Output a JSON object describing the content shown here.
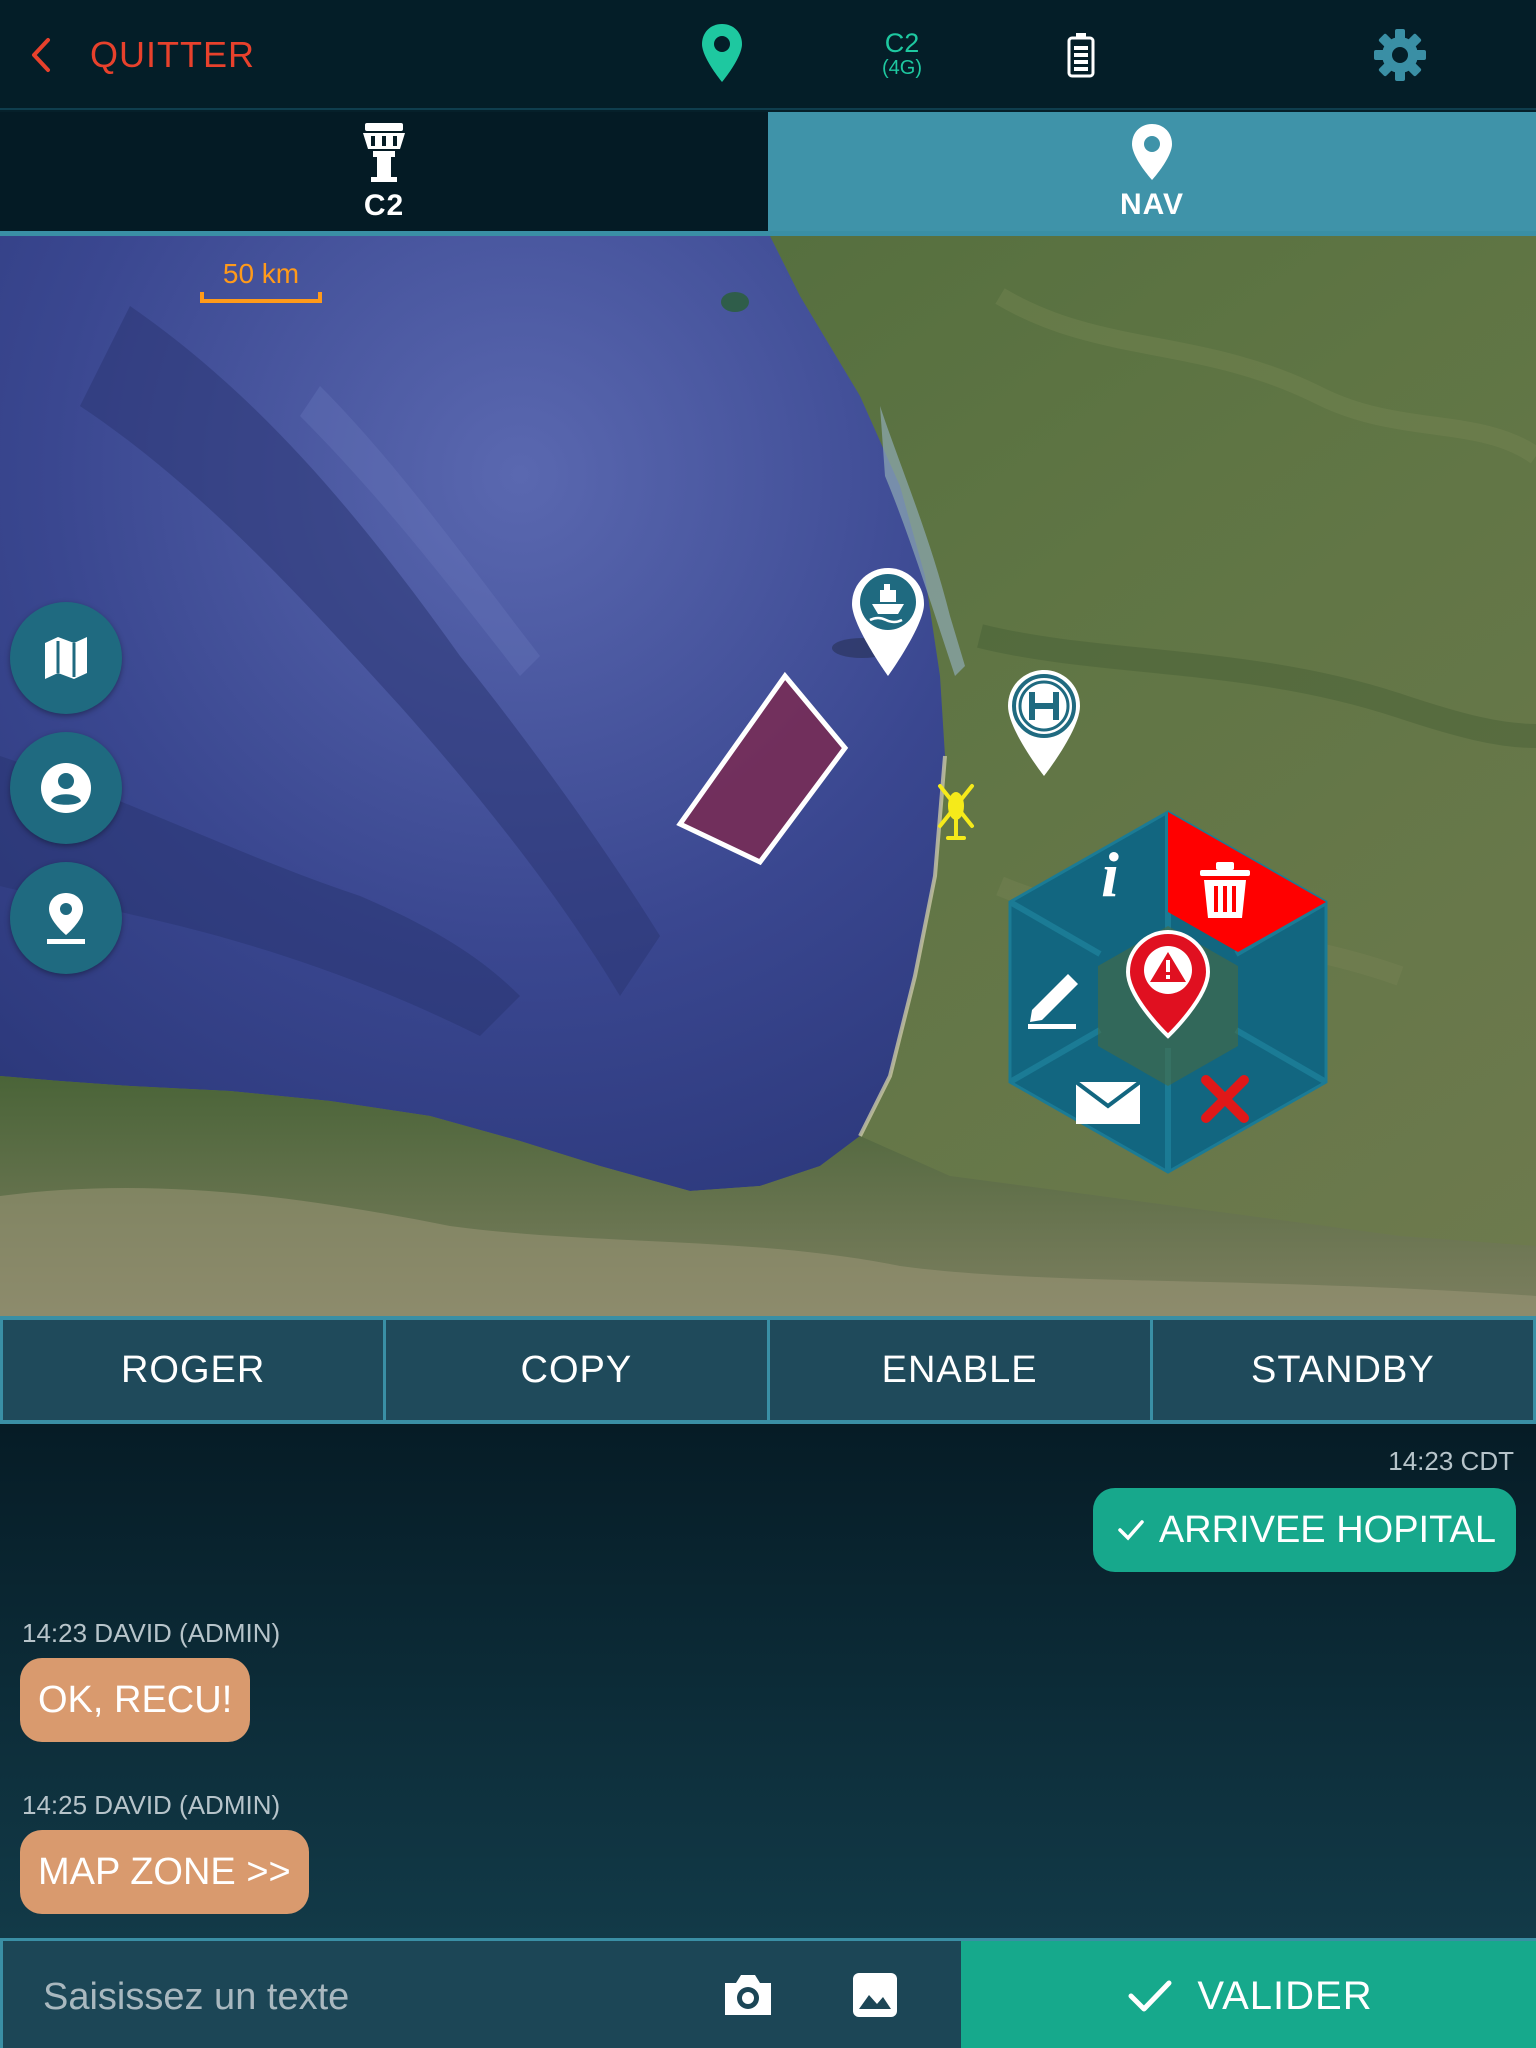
{
  "topbar": {
    "quit_label": "QUITTER",
    "network_line1": "C2",
    "network_line2": "(4G)",
    "icons": [
      "back-chevron-icon",
      "location-pin-icon",
      "battery-icon",
      "gear-icon"
    ]
  },
  "tabs": [
    {
      "label": "C2",
      "icon": "control-tower-icon",
      "active": false
    },
    {
      "label": "NAV",
      "icon": "location-pin-icon",
      "active": true
    }
  ],
  "map": {
    "scale_label": "50 km",
    "markers": [
      "boat-marker-icon",
      "hospital-marker-icon",
      "helicopter-icon",
      "alert-marker-icon"
    ],
    "radial_menu": [
      "info-icon",
      "trash-icon",
      "edit-icon",
      "mail-icon",
      "close-icon"
    ],
    "side_buttons": [
      "map-icon",
      "user-icon",
      "pin-icon"
    ],
    "colors": {
      "zone": "#7a2a52",
      "trash_segment": "#ff0000",
      "menu_segment": "#126680"
    }
  },
  "quick_replies": [
    "ROGER",
    "COPY",
    "ENABLE",
    "STANDBY"
  ],
  "chat": {
    "messages": [
      {
        "time": "14:23 CDT",
        "text": "ARRIVEE HOPITAL",
        "direction": "out"
      },
      {
        "meta": "14:23 DAVID (ADMIN)",
        "text": "OK, RECU!",
        "direction": "in"
      },
      {
        "meta": "14:25 DAVID (ADMIN)",
        "text": "MAP ZONE >>",
        "direction": "in"
      }
    ]
  },
  "input": {
    "placeholder": "Saisissez un texte",
    "submit_label": "VALIDER"
  },
  "colors": {
    "accent": "#16a98c",
    "alert": "#e8412c",
    "tab_active": "#3f93a9",
    "bubble_in": "#d99a6e"
  }
}
